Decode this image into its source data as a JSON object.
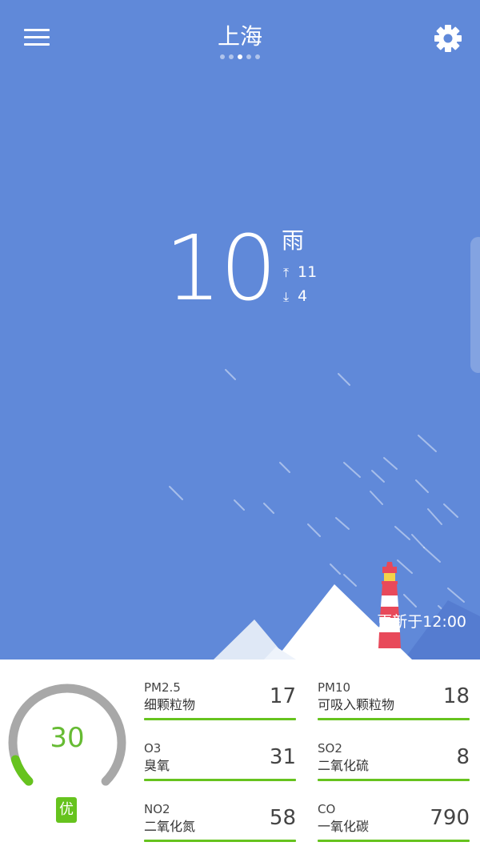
{
  "header": {
    "city": "上海",
    "page_count": 5,
    "active_page": 2
  },
  "weather": {
    "temperature": "10",
    "condition": "雨",
    "high_arrow": "⤒",
    "high": "11",
    "low_arrow": "⤓",
    "low": "4"
  },
  "update_time": "更新于12:00",
  "aqi": {
    "value": "30",
    "level": "优",
    "fraction": 0.1,
    "color": "#66c31e"
  },
  "pollutants": [
    {
      "name": "PM2.5",
      "label": "细颗粒物",
      "value": "17"
    },
    {
      "name": "PM10",
      "label": "可吸入颗粒物",
      "value": "18"
    },
    {
      "name": "O3",
      "label": "臭氧",
      "value": "31"
    },
    {
      "name": "SO2",
      "label": "二氧化硫",
      "value": "8"
    },
    {
      "name": "NO2",
      "label": "二氧化氮",
      "value": "58"
    },
    {
      "name": "CO",
      "label": "一氧化碳",
      "value": "790"
    }
  ],
  "colors": {
    "sky": "#6089d9",
    "good": "#66c31e",
    "gauge_track": "#a8a8a8",
    "lighthouse_red": "#e8495a"
  },
  "icons": {
    "menu": "menu-icon",
    "settings": "gear-icon"
  }
}
